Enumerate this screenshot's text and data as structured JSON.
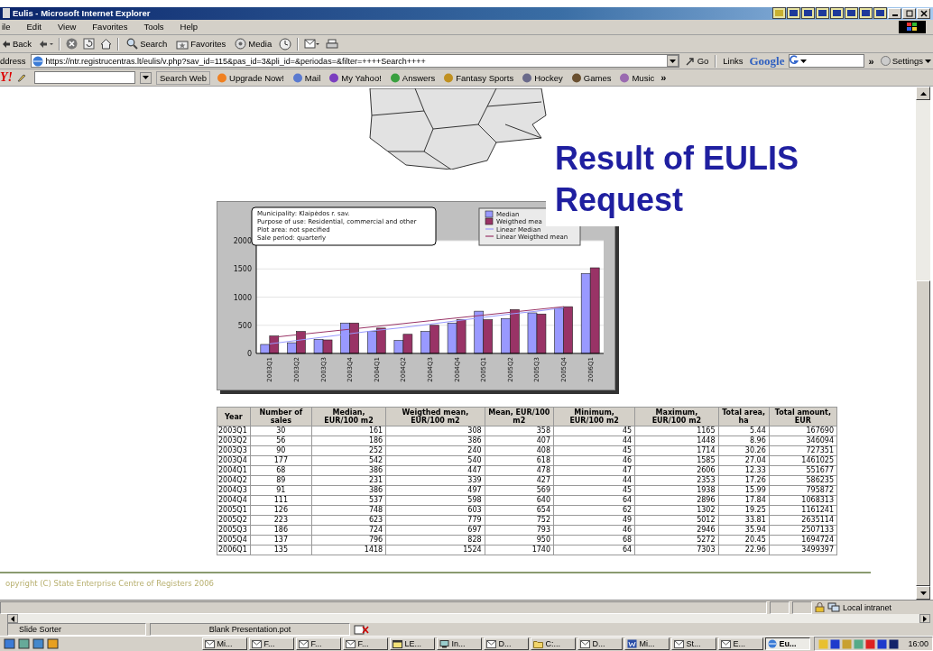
{
  "window": {
    "title": "Eulis - Microsoft Internet Explorer"
  },
  "menu": [
    "ile",
    "Edit",
    "View",
    "Favorites",
    "Tools",
    "Help"
  ],
  "toolbar": [
    {
      "kind": "back",
      "label": "Back"
    },
    {
      "kind": "forward"
    },
    {
      "kind": "stop"
    },
    {
      "kind": "refresh"
    },
    {
      "kind": "home"
    },
    {
      "kind": "search",
      "label": "Search"
    },
    {
      "kind": "favorites",
      "label": "Favorites"
    },
    {
      "kind": "media",
      "label": "Media"
    },
    {
      "kind": "history"
    },
    {
      "kind": "mail"
    },
    {
      "kind": "print"
    }
  ],
  "address_bar": {
    "label": "ddress",
    "url": "https://ntr.registrucentras.lt/eulis/v.php?sav_id=115&pas_id=3&pli_id=&periodas=&filter=++++Search++++",
    "go": "Go",
    "links": "Links",
    "search_brand": "Google",
    "more": "»",
    "settings": "Settings"
  },
  "yahoo_toolbar": {
    "logo": "Y!",
    "search_button": "Search Web",
    "items": [
      "Upgrade Now!",
      "Mail",
      "My Yahoo!",
      "Answers",
      "Fantasy Sports",
      "Hockey",
      "Games",
      "Music"
    ],
    "more": "»"
  },
  "page": {
    "slide_title": "Result of EULIS Request",
    "chart": {
      "info_lines": [
        "Municipality: Klaipėdos r. sav.",
        "Purpose of use: Residential, commercial and other",
        "Plot area: not specified",
        "Sale period: quarterly"
      ],
      "chart_data": {
        "type": "bar",
        "categories": [
          "2003Q1",
          "2003Q2",
          "2003Q3",
          "2003Q4",
          "2004Q1",
          "2004Q2",
          "2004Q3",
          "2004Q4",
          "2005Q1",
          "2005Q2",
          "2005Q3",
          "2005Q4",
          "2006Q1"
        ],
        "series": [
          {
            "name": "Median",
            "type": "bar",
            "color": "#9999ff",
            "values": [
              160,
              190,
              250,
              540,
              390,
              230,
              390,
              540,
              750,
              620,
              720,
              800,
              1420
            ]
          },
          {
            "name": "Weigthed mea",
            "type": "bar",
            "color": "#993366",
            "values": [
              310,
              390,
              240,
              540,
              450,
              340,
              500,
              600,
              600,
              780,
              700,
              830,
              1520
            ]
          },
          {
            "name": "Linear Median",
            "type": "line",
            "color": "#9999ff",
            "values": [
              170,
              230,
              290,
              350,
              410,
              460,
              520,
              580,
              640,
              700,
              750,
              810,
              null
            ]
          },
          {
            "name": "Linear Weigthed mean",
            "type": "line",
            "color": "#993366",
            "values": [
              280,
              330,
              380,
              430,
              480,
              530,
              580,
              630,
              680,
              730,
              780,
              830,
              null
            ]
          }
        ],
        "ylim": [
          0,
          2000
        ],
        "yticks": [
          0,
          500,
          1000,
          1500,
          2000
        ],
        "grid": true,
        "legend": "upper right"
      }
    },
    "table": {
      "columns": [
        "Year",
        "Number of sales",
        "Median, EUR/100 m2",
        "Weigthed mean, EUR/100 m2",
        "Mean, EUR/100 m2",
        "Minimum, EUR/100 m2",
        "Maximum, EUR/100 m2",
        "Total area, ha",
        "Total amount, EUR"
      ],
      "rows": [
        [
          "2003Q1",
          "30",
          "161",
          "308",
          "358",
          "45",
          "1165",
          "5.44",
          "167690"
        ],
        [
          "2003Q2",
          "56",
          "186",
          "386",
          "407",
          "44",
          "1448",
          "8.96",
          "346094"
        ],
        [
          "2003Q3",
          "90",
          "252",
          "240",
          "408",
          "45",
          "1714",
          "30.26",
          "727351"
        ],
        [
          "2003Q4",
          "177",
          "542",
          "540",
          "618",
          "46",
          "1585",
          "27.04",
          "1461025"
        ],
        [
          "2004Q1",
          "68",
          "386",
          "447",
          "478",
          "47",
          "2606",
          "12.33",
          "551677"
        ],
        [
          "2004Q2",
          "89",
          "231",
          "339",
          "427",
          "44",
          "2353",
          "17.26",
          "586235"
        ],
        [
          "2004Q3",
          "91",
          "386",
          "497",
          "569",
          "45",
          "1938",
          "15.99",
          "795872"
        ],
        [
          "2004Q4",
          "111",
          "537",
          "598",
          "640",
          "64",
          "2896",
          "17.84",
          "1068313"
        ],
        [
          "2005Q1",
          "126",
          "748",
          "603",
          "654",
          "62",
          "1302",
          "19.25",
          "1161241"
        ],
        [
          "2005Q2",
          "223",
          "623",
          "779",
          "752",
          "49",
          "5012",
          "33.81",
          "2635114"
        ],
        [
          "2005Q3",
          "186",
          "724",
          "697",
          "793",
          "46",
          "2946",
          "35.94",
          "2507133"
        ],
        [
          "2005Q4",
          "137",
          "796",
          "828",
          "950",
          "68",
          "5272",
          "20.45",
          "1694724"
        ],
        [
          "2006Q1",
          "135",
          "1418",
          "1524",
          "1740",
          "64",
          "7303",
          "22.96",
          "3499397"
        ]
      ]
    },
    "footer": "opyright (C) State Enterprise Centre of Registers 2006"
  },
  "status_bar": {
    "zone": "Local intranet"
  },
  "ppt_status": [
    "Slide Sorter",
    "Blank Presentation.pot"
  ],
  "taskbar": {
    "items": [
      {
        "label": "Mi...",
        "selected": false
      },
      {
        "label": "F...",
        "selected": false
      },
      {
        "label": "F...",
        "selected": false
      },
      {
        "label": "F...",
        "selected": false
      },
      {
        "label": "LE...",
        "selected": false
      },
      {
        "label": "In...",
        "selected": false
      },
      {
        "label": "D...",
        "selected": false
      },
      {
        "label": "C:...",
        "selected": false
      },
      {
        "label": "D...",
        "selected": false
      },
      {
        "label": "Mi...",
        "selected": false
      },
      {
        "label": "St...",
        "selected": false
      },
      {
        "label": "E...",
        "selected": false
      },
      {
        "label": "Eu...",
        "selected": true
      }
    ],
    "clock": "16:00"
  }
}
